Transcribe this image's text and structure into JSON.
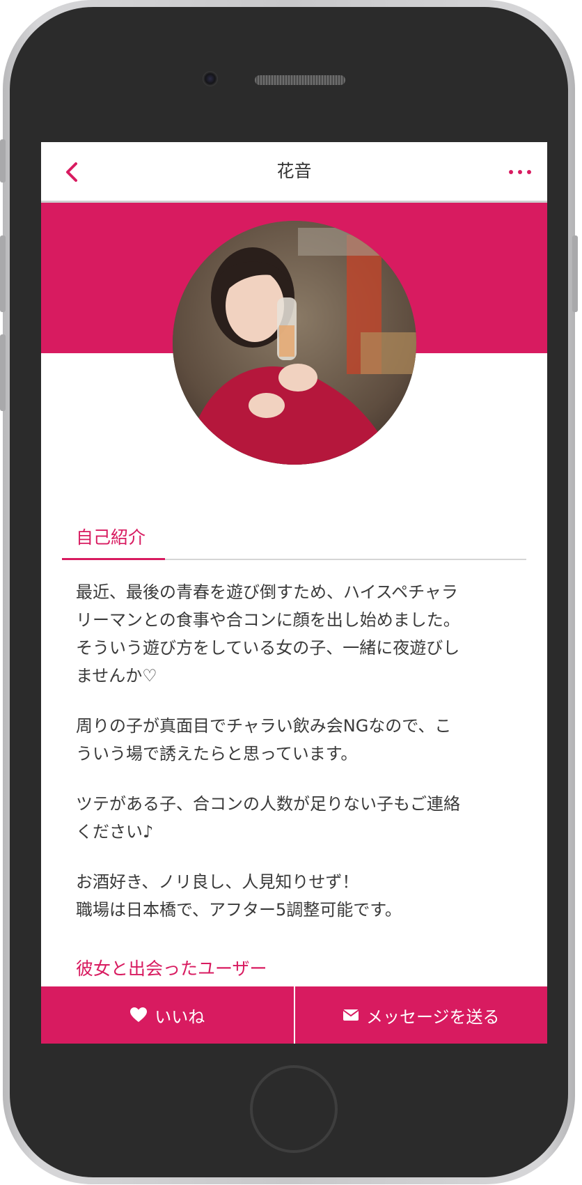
{
  "nav": {
    "title": "花音",
    "back_icon": "chevron-left-icon",
    "more_icon": "more-horizontal-icon"
  },
  "profile": {
    "avatar_description": "profile-photo"
  },
  "intro_section": {
    "title": "自己紹介",
    "paragraphs": [
      "最近、最後の青春を遊び倒すため、ハイスペチャラ\nリーマンとの食事や合コンに顔を出し始めました。\nそういう遊び方をしている女の子、一緒に夜遊びし\nませんか♡",
      "周りの子が真面目でチャラい飲み会NGなので、こ\nういう場で誘えたらと思っています。",
      "ツテがある子、合コンの人数が足りない子もご連絡\nください♪",
      "お酒好き、ノリ良し、人見知りせず！\n職場は日本橋で、アフター5調整可能です。"
    ]
  },
  "met_section": {
    "title": "彼女と出会ったユーザー"
  },
  "actions": {
    "like_label": "いいね",
    "message_label": "メッセージを送る"
  },
  "colors": {
    "accent": "#d81b60",
    "frame": "#2b2b2b"
  }
}
